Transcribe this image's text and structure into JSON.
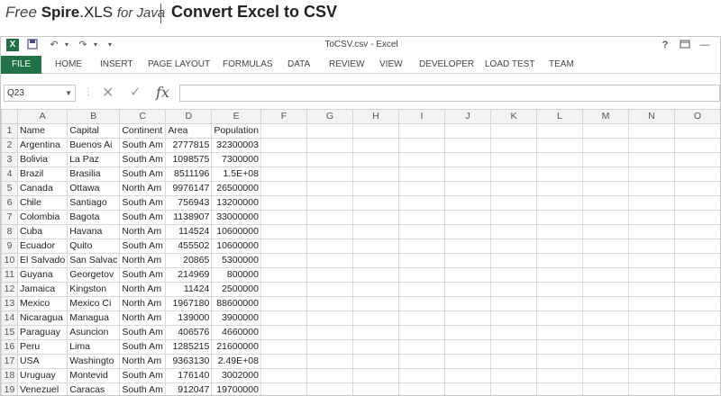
{
  "banner": {
    "free": "Free",
    "spire": "Spire",
    "xls": ".XLS",
    "for_java": "for Java",
    "title": "Convert Excel to CSV"
  },
  "titlebar": {
    "doc_title": "ToCSV.csv - Excel",
    "help": "?",
    "icons": {
      "logo": "excel-logo",
      "save": "save-icon",
      "undo": "undo-icon",
      "redo": "redo-icon"
    }
  },
  "ribbon": {
    "tabs": [
      "FILE",
      "HOME",
      "INSERT",
      "PAGE LAYOUT",
      "FORMULAS",
      "DATA",
      "REVIEW",
      "VIEW",
      "DEVELOPER",
      "LOAD TEST",
      "TEAM"
    ]
  },
  "formula_bar": {
    "name_box": "Q23",
    "fx": "fx",
    "value": ""
  },
  "sheet": {
    "columns": [
      "A",
      "B",
      "C",
      "D",
      "E",
      "F",
      "G",
      "H",
      "I",
      "J",
      "K",
      "L",
      "M",
      "N",
      "O"
    ],
    "rows": [
      [
        "Name",
        "Capital",
        "Continent",
        "Area",
        "Population"
      ],
      [
        "Argentina",
        "Buenos Ai",
        "South Am",
        "2777815",
        "32300003"
      ],
      [
        "Bolivia",
        "La Paz",
        "South Am",
        "1098575",
        "7300000"
      ],
      [
        "Brazil",
        "Brasilia",
        "South Am",
        "8511196",
        "1.5E+08"
      ],
      [
        "Canada",
        "Ottawa",
        "North Am",
        "9976147",
        "26500000"
      ],
      [
        "Chile",
        "Santiago",
        "South Am",
        "756943",
        "13200000"
      ],
      [
        "Colombia",
        "Bagota",
        "South Am",
        "1138907",
        "33000000"
      ],
      [
        "Cuba",
        "Havana",
        "North Am",
        "114524",
        "10600000"
      ],
      [
        "Ecuador",
        "Quito",
        "South Am",
        "455502",
        "10600000"
      ],
      [
        "El Salvado",
        "San Salvac",
        "North Am",
        "20865",
        "5300000"
      ],
      [
        "Guyana",
        "Georgetov",
        "South Am",
        "214969",
        "800000"
      ],
      [
        "Jamaica",
        "Kingston",
        "North Am",
        "11424",
        "2500000"
      ],
      [
        "Mexico",
        "Mexico Ci",
        "North Am",
        "1967180",
        "88600000"
      ],
      [
        "Nicaragua",
        "Managua",
        "North Am",
        "139000",
        "3900000"
      ],
      [
        "Paraguay",
        "Asuncion",
        "South Am",
        "406576",
        "4660000"
      ],
      [
        "Peru",
        "Lima",
        "South Am",
        "1285215",
        "21600000"
      ],
      [
        "USA",
        "Washingto",
        "North Am",
        "9363130",
        "2.49E+08"
      ],
      [
        "Uruguay",
        "Montevid",
        "South Am",
        "176140",
        "3002000"
      ],
      [
        "Venezuel",
        "Caracas",
        "South Am",
        "912047",
        "19700000"
      ]
    ]
  }
}
